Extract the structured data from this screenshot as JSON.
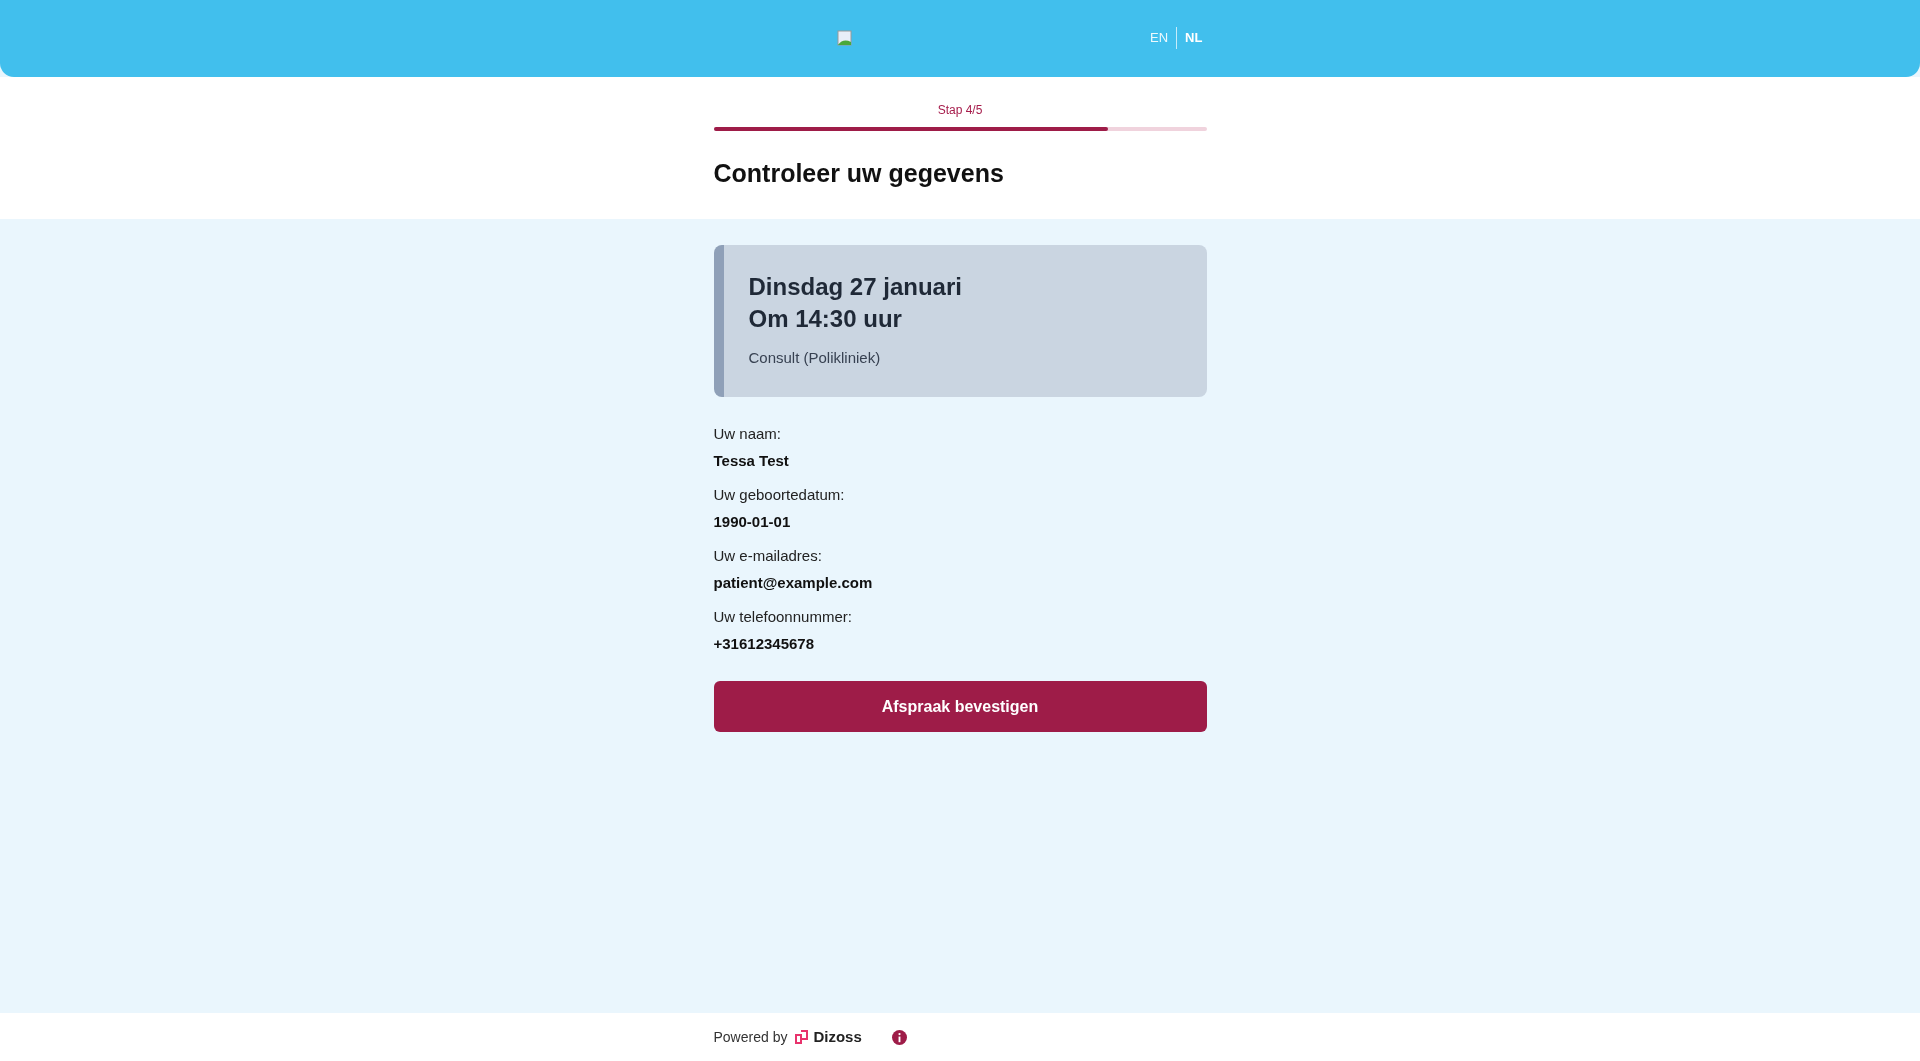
{
  "header": {
    "languages": [
      {
        "label": "EN",
        "selected": false
      },
      {
        "label": "NL",
        "selected": true
      }
    ]
  },
  "progress": {
    "label": "Stap 4/5",
    "level": 0.8
  },
  "title": "Controleer uw gegevens",
  "appointment": {
    "date": "Dinsdag 27 januari",
    "time": "Om 14:30 uur",
    "type": "Consult (Polikliniek)"
  },
  "fields": [
    {
      "label": "Uw naam:",
      "value": "Tessa Test"
    },
    {
      "label": "Uw geboortedatum:",
      "value": "1990-01-01"
    },
    {
      "label": "Uw e-mailadres:",
      "value": "patient@example.com"
    },
    {
      "label": "Uw telefoonnummer:",
      "value": "+31612345678"
    }
  ],
  "confirm_button": "Afspraak bevestigen",
  "footer": {
    "powered_by": "Powered by",
    "brand": "Dizoss"
  }
}
